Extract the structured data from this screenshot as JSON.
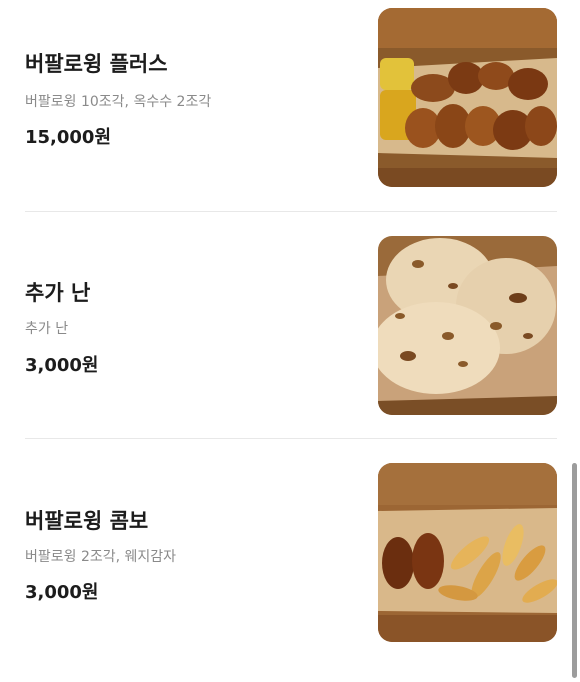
{
  "menu": {
    "items": [
      {
        "name": "버팔로윙 플러스",
        "description": "버팔로윙 10조각, 옥수수 2조각",
        "price": "15,000원",
        "image_icon": "buffalo-wings-corn-image"
      },
      {
        "name": "추가 난",
        "description": "추가 난",
        "price": "3,000원",
        "image_icon": "naan-bread-image"
      },
      {
        "name": "버팔로윙 콤보",
        "description": "버팔로윙 2조각, 웨지감자",
        "price": "3,000원",
        "image_icon": "wings-wedges-image"
      }
    ]
  },
  "colors": {
    "title": "#1c1c1c",
    "description": "#8a8a8a",
    "divider": "#e8e8e8",
    "scrollbar": "#9c9c9c"
  }
}
